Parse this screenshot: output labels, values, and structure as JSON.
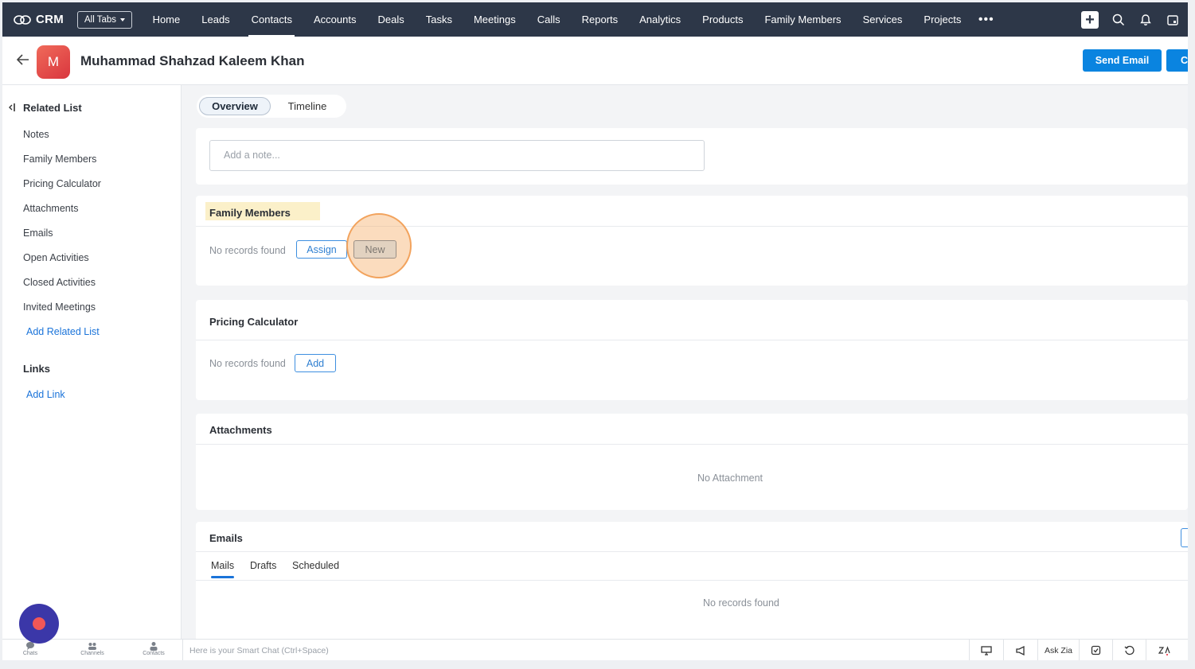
{
  "topnav": {
    "brand": "CRM",
    "all_tabs": "All Tabs",
    "tabs": [
      "Home",
      "Leads",
      "Contacts",
      "Accounts",
      "Deals",
      "Tasks",
      "Meetings",
      "Calls",
      "Reports",
      "Analytics",
      "Products",
      "Family Members",
      "Services",
      "Projects"
    ],
    "active_tab": "Contacts",
    "more": "•••"
  },
  "record": {
    "avatar_letter": "M",
    "name": "Muhammad Shahzad Kaleem Khan",
    "send_email": "Send Email",
    "second_button": "C"
  },
  "sidebar": {
    "related_title": "Related List",
    "items": [
      "Notes",
      "Family Members",
      "Pricing Calculator",
      "Attachments",
      "Emails",
      "Open Activities",
      "Closed Activities",
      "Invited Meetings"
    ],
    "add_related": "Add Related List",
    "links_title": "Links",
    "add_link": "Add Link"
  },
  "tabs": {
    "overview": "Overview",
    "timeline": "Timeline"
  },
  "notes": {
    "placeholder": "Add a note..."
  },
  "family": {
    "title": "Family Members",
    "empty": "No records found",
    "assign": "Assign",
    "new": "New"
  },
  "pricing": {
    "title": "Pricing Calculator",
    "empty": "No records found",
    "add": "Add"
  },
  "attachments": {
    "title": "Attachments",
    "empty": "No Attachment"
  },
  "emails": {
    "title": "Emails",
    "tabs": [
      "Mails",
      "Drafts",
      "Scheduled"
    ],
    "empty": "No records found"
  },
  "bottombar": {
    "items": [
      "Chats",
      "Channels",
      "Contacts"
    ],
    "smartchat": "Here is your Smart Chat (Ctrl+Space)",
    "ask_zia": "Ask Zia"
  },
  "colors": {
    "nav": "#2d3748",
    "primary": "#0a84e0",
    "highlight": "#f2a35d"
  }
}
